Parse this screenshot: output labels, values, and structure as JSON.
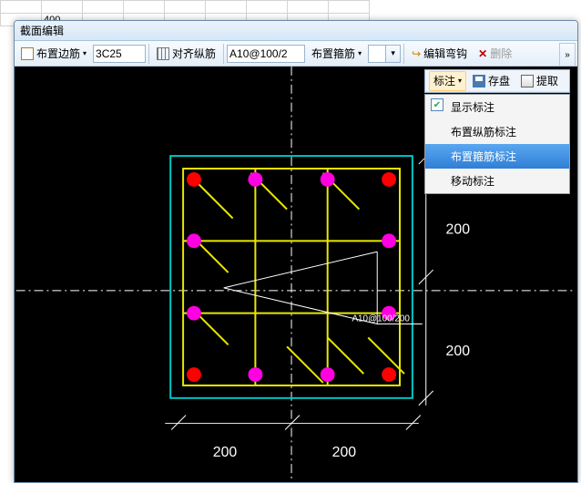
{
  "spreadsheet_cell": "400",
  "window_title": "截面编辑",
  "toolbar1": {
    "edge_rebar_btn": "布置边筋",
    "edge_rebar_value": "3C25",
    "align_btn": "对齐纵筋",
    "stirrup_value": "A10@100/2",
    "stirrup_btn": "布置箍筋",
    "edit_hook": "编辑弯钩",
    "delete": "删除"
  },
  "toolbar2": {
    "annotate": "标注",
    "save": "存盘",
    "extract": "提取"
  },
  "menu": {
    "show_annot": "显示标注",
    "long_annot": "布置纵筋标注",
    "stirrup_annot": "布置箍筋标注",
    "move_annot": "移动标注"
  },
  "drawing": {
    "dim_x1": "200",
    "dim_x2": "200",
    "dim_y1": "200",
    "dim_y2": "200",
    "stirrup_label": "A10@100/200"
  }
}
